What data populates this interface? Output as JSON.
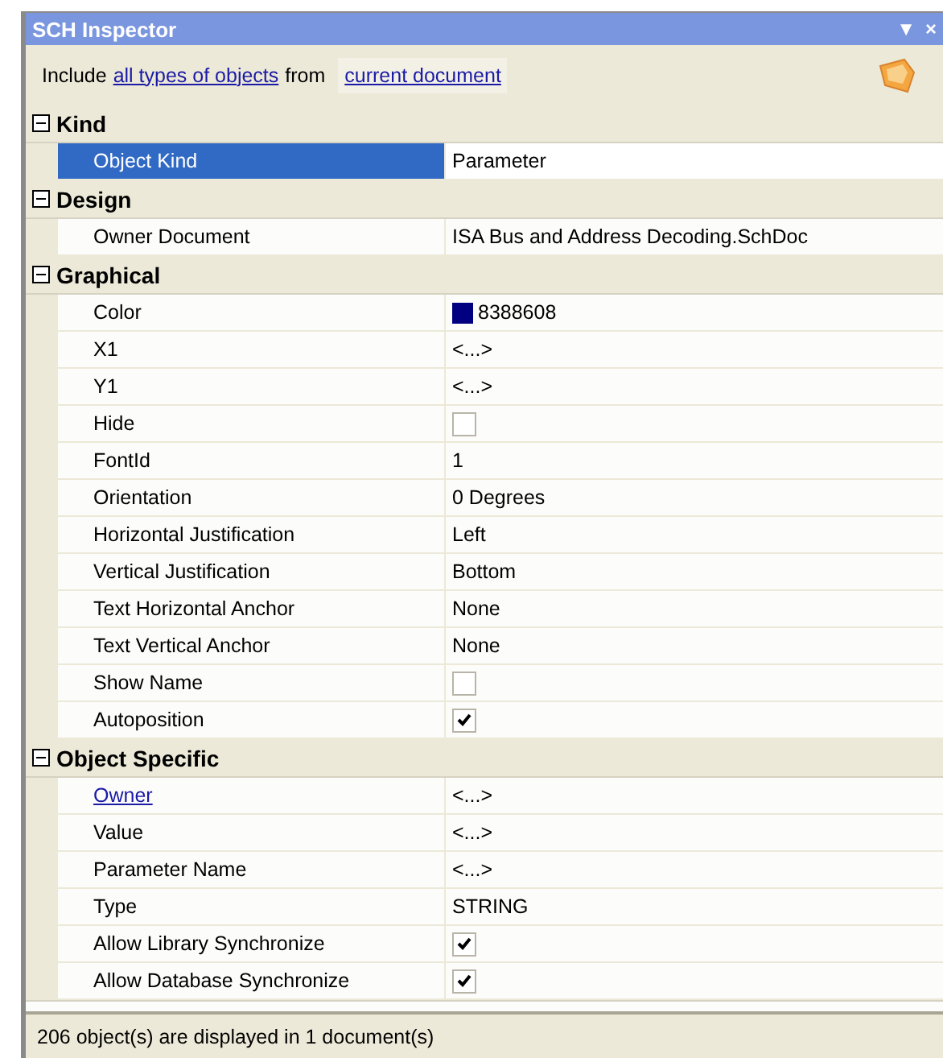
{
  "window": {
    "title": "SCH Inspector",
    "buttons": [
      "▼",
      "×"
    ]
  },
  "filter": {
    "prefix": "Include",
    "scope": "all types of objects",
    "middle": "from",
    "source": "current document"
  },
  "categories": [
    {
      "name": "Kind",
      "expanded": true,
      "properties": [
        {
          "label": "Object Kind",
          "kind": "text",
          "value": "Parameter",
          "selected": true,
          "link": false
        }
      ]
    },
    {
      "name": "Design",
      "expanded": true,
      "properties": [
        {
          "label": "Owner Document",
          "kind": "text",
          "value": "ISA Bus and Address Decoding.SchDoc",
          "selected": false,
          "link": false
        }
      ]
    },
    {
      "name": "Graphical",
      "expanded": true,
      "properties": [
        {
          "label": "Color",
          "kind": "color",
          "value": "8388608",
          "color": "#000080",
          "selected": false,
          "link": false
        },
        {
          "label": "X1",
          "kind": "text",
          "value": "<...>",
          "selected": false,
          "link": false
        },
        {
          "label": "Y1",
          "kind": "text",
          "value": "<...>",
          "selected": false,
          "link": false
        },
        {
          "label": "Hide",
          "kind": "checkbox",
          "checked": false,
          "selected": false,
          "link": false
        },
        {
          "label": "FontId",
          "kind": "text",
          "value": "1",
          "selected": false,
          "link": false
        },
        {
          "label": "Orientation",
          "kind": "text",
          "value": "0 Degrees",
          "selected": false,
          "link": false
        },
        {
          "label": "Horizontal Justification",
          "kind": "text",
          "value": "Left",
          "selected": false,
          "link": false
        },
        {
          "label": "Vertical Justification",
          "kind": "text",
          "value": "Bottom",
          "selected": false,
          "link": false
        },
        {
          "label": "Text Horizontal Anchor",
          "kind": "text",
          "value": "None",
          "selected": false,
          "link": false
        },
        {
          "label": "Text Vertical Anchor",
          "kind": "text",
          "value": "None",
          "selected": false,
          "link": false
        },
        {
          "label": "Show Name",
          "kind": "checkbox",
          "checked": false,
          "selected": false,
          "link": false
        },
        {
          "label": "Autoposition",
          "kind": "checkbox",
          "checked": true,
          "selected": false,
          "link": false
        }
      ]
    },
    {
      "name": "Object Specific",
      "expanded": true,
      "properties": [
        {
          "label": "Owner",
          "kind": "text",
          "value": "<...>",
          "selected": false,
          "link": true
        },
        {
          "label": "Value",
          "kind": "text",
          "value": "<...>",
          "selected": false,
          "link": false
        },
        {
          "label": "Parameter Name",
          "kind": "text",
          "value": "<...>",
          "selected": false,
          "link": false
        },
        {
          "label": "Type",
          "kind": "text",
          "value": "STRING",
          "selected": false,
          "link": false
        },
        {
          "label": "Allow Library Synchronize",
          "kind": "checkbox",
          "checked": true,
          "selected": false,
          "link": false
        },
        {
          "label": "Allow Database Synchronize",
          "kind": "checkbox",
          "checked": true,
          "selected": false,
          "link": false
        }
      ]
    }
  ],
  "status_bar": "206 object(s) are displayed in 1 document(s)"
}
